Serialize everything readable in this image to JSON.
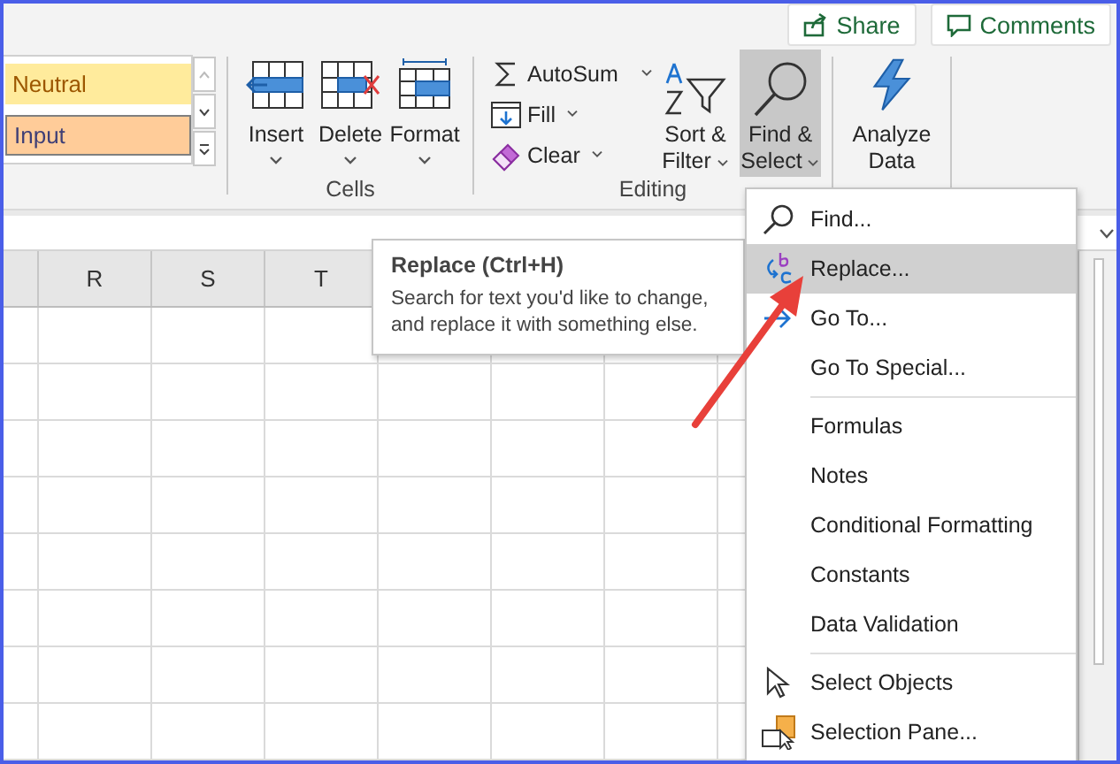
{
  "header_buttons": [
    {
      "label": "Share",
      "kind": "share"
    },
    {
      "label": "Comments",
      "kind": "comments"
    }
  ],
  "ribbon": {
    "styles": [
      {
        "label": "Neutral",
        "kind": "neutral"
      },
      {
        "label": "Input",
        "kind": "input"
      }
    ],
    "cells": {
      "label": "Cells",
      "buttons": [
        {
          "label": "Insert",
          "kind": "insert"
        },
        {
          "label": "Delete",
          "kind": "delete"
        },
        {
          "label": "Format",
          "kind": "format"
        }
      ]
    },
    "editing": {
      "label": "Editing",
      "small_buttons": [
        {
          "label": "AutoSum",
          "kind": "autosum"
        },
        {
          "label": "Fill",
          "kind": "fill"
        },
        {
          "label": "Clear",
          "kind": "clear"
        }
      ],
      "large_buttons": [
        {
          "lines": [
            "Sort &",
            "Filter"
          ],
          "kind": "sort",
          "selected": false
        },
        {
          "lines": [
            "Find &",
            "Select"
          ],
          "kind": "find",
          "selected": true
        }
      ]
    },
    "analyze": {
      "lines": [
        "Analyze",
        "Data"
      ]
    }
  },
  "sheet": {
    "columns": [
      "R",
      "S",
      "T"
    ]
  },
  "tooltip": {
    "title": "Replace (Ctrl+H)",
    "text": "Search for text you'd like to change, and replace it with something else."
  },
  "menu": {
    "items": [
      {
        "kind": "item",
        "label": "Find...",
        "selected": false
      },
      {
        "kind": "item",
        "label": "Replace...",
        "selected": true
      },
      {
        "kind": "item",
        "label": "Go To...",
        "selected": false
      },
      {
        "kind": "item",
        "label": "Go To Special...",
        "selected": false
      },
      {
        "kind": "separator"
      },
      {
        "kind": "item",
        "label": "Formulas",
        "selected": false
      },
      {
        "kind": "item",
        "label": "Notes",
        "selected": false
      },
      {
        "kind": "item",
        "label": "Conditional Formatting",
        "selected": false
      },
      {
        "kind": "item",
        "label": "Constants",
        "selected": false
      },
      {
        "kind": "item",
        "label": "Data Validation",
        "selected": false
      },
      {
        "kind": "separator"
      },
      {
        "kind": "item",
        "label": "Select Objects",
        "selected": false
      },
      {
        "kind": "item",
        "label": "Selection Pane...",
        "selected": false
      }
    ]
  }
}
